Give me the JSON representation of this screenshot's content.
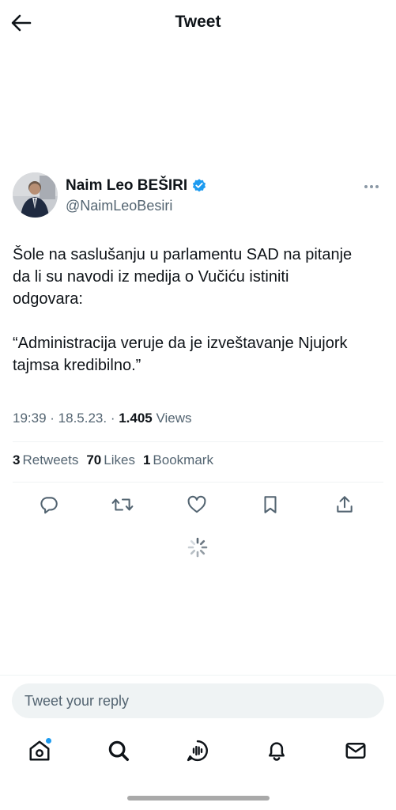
{
  "header": {
    "title": "Tweet"
  },
  "author": {
    "name": "Naim Leo BEŠIRI",
    "handle": "@NaimLeoBesiri",
    "verified": true
  },
  "tweet": {
    "text": "Šole na saslušanju u parlamentu SAD na pitanje\nda li su navodi iz medija o Vučiću istiniti\nodgovara:\n\n“Administracija veruje da je izveštavanje Njujork\ntajmsa kredibilno.”",
    "time": "19:39",
    "sep1": " · ",
    "date": "18.5.23.",
    "sep2": " · ",
    "views_count": "1.405",
    "views_label": " Views"
  },
  "stats": {
    "retweets_count": "3",
    "retweets_label": "Retweets",
    "likes_count": "70",
    "likes_label": "Likes",
    "bookmarks_count": "1",
    "bookmarks_label": "Bookmark"
  },
  "actions": [
    "reply-icon",
    "retweet-icon",
    "like-icon",
    "bookmark-icon",
    "share-icon"
  ],
  "reply": {
    "placeholder": "Tweet your reply"
  },
  "nav": [
    "home-icon",
    "search-icon",
    "spaces-icon",
    "notifications-icon",
    "messages-icon"
  ],
  "colors": {
    "accent": "#1d9bf0",
    "text": "#0f1419",
    "muted": "#536471",
    "divider": "#eff3f4"
  }
}
